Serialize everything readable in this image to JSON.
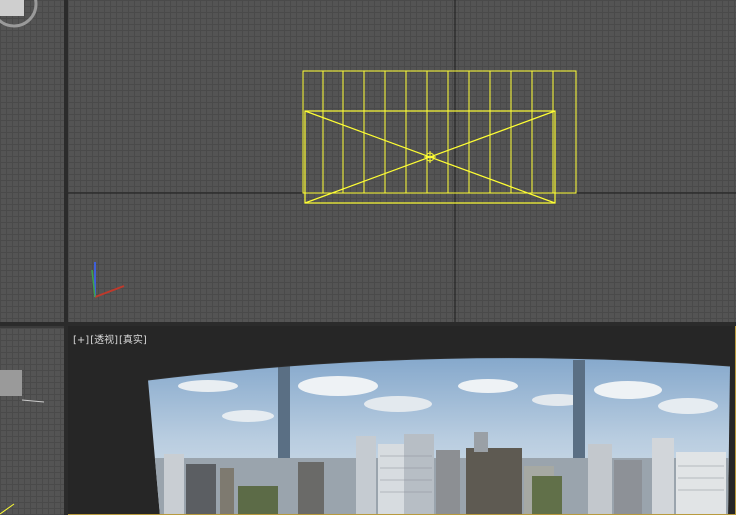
{
  "perspective_viewport": {
    "label_plus": "[+]",
    "label_view": "[透视]",
    "label_shading": "[真实]"
  },
  "colors": {
    "viewport_bg": "#545454",
    "grid_line": "#4a4a4a",
    "selection_wireframe": "#ffff33",
    "active_border": "#b89a3e"
  },
  "icons": {
    "axis_gizmo": "axis-tripod-icon",
    "view_cube": "view-cube-icon",
    "pivot": "pivot-point-icon"
  }
}
